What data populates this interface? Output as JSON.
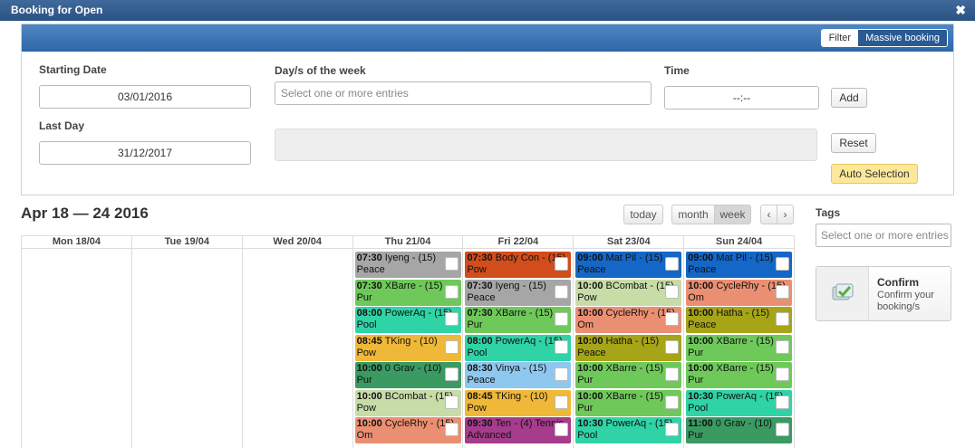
{
  "window": {
    "title": "Booking for Open"
  },
  "toolbar": {
    "filter": "Filter",
    "massive": "Massive booking"
  },
  "form": {
    "starting_date_label": "Starting Date",
    "starting_date_value": "03/01/2016",
    "last_day_label": "Last Day",
    "last_day_value": "31/12/2017",
    "days_label": "Day/s of the week",
    "days_placeholder": "Select one or more entries",
    "time_label": "Time",
    "time_value": "--:--",
    "add": "Add",
    "reset": "Reset",
    "auto_selection": "Auto Selection"
  },
  "calendar": {
    "title": "Apr 18 — 24 2016",
    "today": "today",
    "month": "month",
    "week": "week",
    "prev": "‹",
    "next": "›",
    "days": [
      "Mon 18/04",
      "Tue 19/04",
      "Wed 20/04",
      "Thu 21/04",
      "Fri 22/04",
      "Sat 23/04",
      "Sun 24/04"
    ],
    "events": [
      [],
      [],
      [],
      [
        {
          "time": "07:30",
          "text": "Iyeng - (15) Peace",
          "color": "#a6a6a6"
        },
        {
          "time": "07:30",
          "text": "XBarre - (15) Pur",
          "color": "#6fc95a"
        },
        {
          "time": "08:00",
          "text": "PowerAq - (15) Pool",
          "color": "#2fd3a6"
        },
        {
          "time": "08:45",
          "text": "TKing - (10) Pow",
          "color": "#f0b838"
        },
        {
          "time": "10:00",
          "text": "0 Grav - (10) Pur",
          "color": "#3a9a62"
        },
        {
          "time": "10:00",
          "text": "BCombat - (15) Pow",
          "color": "#c8dca8"
        },
        {
          "time": "10:00",
          "text": "CycleRhy - (15) Om",
          "color": "#eb8f72"
        }
      ],
      [
        {
          "time": "07:30",
          "text": "Body Con - (15) Pow",
          "color": "#d24d1c"
        },
        {
          "time": "07:30",
          "text": "Iyeng - (15) Peace",
          "color": "#a6a6a6"
        },
        {
          "time": "07:30",
          "text": "XBarre - (15) Pur",
          "color": "#6fc95a"
        },
        {
          "time": "08:00",
          "text": "PowerAq - (15) Pool",
          "color": "#2fd3a6"
        },
        {
          "time": "08:30",
          "text": "Vinya - (15) Peace",
          "color": "#8fc8ee"
        },
        {
          "time": "08:45",
          "text": "TKing - (10) Pow",
          "color": "#f0b838"
        },
        {
          "time": "09:30",
          "text": "Ten - (4) Tennis Advanced",
          "color": "#a63c8c"
        }
      ],
      [
        {
          "time": "09:00",
          "text": "Mat Pil - (15) Peace",
          "color": "#1467c6"
        },
        {
          "time": "10:00",
          "text": "BCombat - (15) Pow",
          "color": "#c8dca8"
        },
        {
          "time": "10:00",
          "text": "CycleRhy - (15) Om",
          "color": "#eb8f72"
        },
        {
          "time": "10:00",
          "text": "Hatha - (15) Peace",
          "color": "#a6a417"
        },
        {
          "time": "10:00",
          "text": "XBarre - (15) Pur",
          "color": "#6fc95a"
        },
        {
          "time": "10:00",
          "text": "XBarre - (15) Pur",
          "color": "#6fc95a"
        },
        {
          "time": "10:30",
          "text": "PowerAq - (15) Pool",
          "color": "#2fd3a6"
        }
      ],
      [
        {
          "time": "09:00",
          "text": "Mat Pil - (15) Peace",
          "color": "#1467c6"
        },
        {
          "time": "10:00",
          "text": "CycleRhy - (15) Om",
          "color": "#eb8f72"
        },
        {
          "time": "10:00",
          "text": "Hatha - (15) Peace",
          "color": "#a6a417"
        },
        {
          "time": "10:00",
          "text": "XBarre - (15) Pur",
          "color": "#6fc95a"
        },
        {
          "time": "10:00",
          "text": "XBarre - (15) Pur",
          "color": "#6fc95a"
        },
        {
          "time": "10:30",
          "text": "PowerAq - (15) Pool",
          "color": "#2fd3a6"
        },
        {
          "time": "11:00",
          "text": "0 Grav - (10) Pur",
          "color": "#3a9a62"
        }
      ]
    ]
  },
  "sidebar": {
    "tags_label": "Tags",
    "tags_placeholder": "Select one or more entries",
    "confirm_title": "Confirm",
    "confirm_sub": "Confirm your booking/s"
  }
}
